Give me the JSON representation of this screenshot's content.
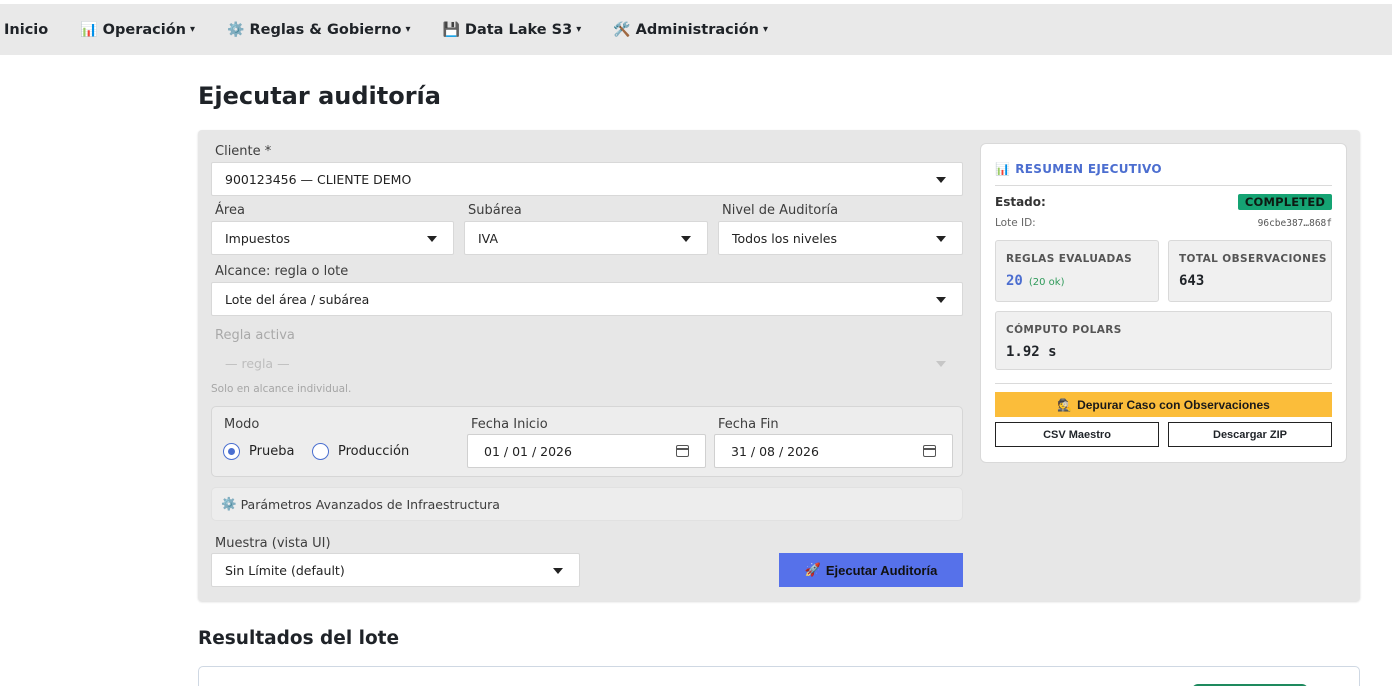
{
  "nav": {
    "items": [
      {
        "label": "Inicio",
        "icon": "",
        "caret": ""
      },
      {
        "label": "Operación",
        "icon": "📊",
        "caret": "▾"
      },
      {
        "label": "Reglas & Gobierno",
        "icon": "⚙️",
        "caret": "▾"
      },
      {
        "label": "Data Lake S3",
        "icon": "💾",
        "caret": "▾"
      },
      {
        "label": "Administración",
        "icon": "🛠️",
        "caret": "▾"
      }
    ]
  },
  "page": {
    "title": "Ejecutar auditoría"
  },
  "form": {
    "cliente_label": "Cliente *",
    "cliente_value": "900123456 — CLIENTE DEMO",
    "area_label": "Área",
    "area_value": "Impuestos",
    "subarea_label": "Subárea",
    "subarea_value": "IVA",
    "nivel_label": "Nivel de Auditoría",
    "nivel_value": "Todos los niveles",
    "alcance_label": "Alcance: regla o lote",
    "alcance_value": "Lote del área / subárea",
    "regla_label": "Regla activa",
    "regla_value": "— regla —",
    "regla_hint": "Solo en alcance individual.",
    "modo_label": "Modo",
    "modo_options": [
      "Prueba",
      "Producción"
    ],
    "modo_selected": "Prueba",
    "fecha_inicio_label": "Fecha Inicio",
    "fecha_inicio_value": "01 / 01 / 2026",
    "fecha_fin_label": "Fecha Fin",
    "fecha_fin_value": "31 / 08 / 2026",
    "advanced_icon": "⚙️",
    "advanced_label": "Parámetros Avanzados de Infraestructura",
    "muestra_label": "Muestra (vista UI)",
    "muestra_value": "Sin Límite (default)",
    "run_icon": "🚀",
    "run_label": "Ejecutar Auditoría"
  },
  "summary": {
    "icon": "📊",
    "title": "RESUMEN EJECUTIVO",
    "estado_label": "Estado:",
    "estado_value": "COMPLETED",
    "lote_label": "Lote ID:",
    "lote_value": "96cbe387…868f",
    "reglas_label": "REGLAS EVALUADAS",
    "reglas_value": "20",
    "reglas_ok": "(20 ok)",
    "obs_label": "TOTAL OBSERVACIONES",
    "obs_value": "643",
    "computo_label": "CÓMPUTO POLARS",
    "computo_value": "1.92 s",
    "debug_icon": "🕵️",
    "debug_label": "Depurar Caso con Observaciones",
    "csv_label": "CSV Maestro",
    "zip_label": "Descargar ZIP"
  },
  "results": {
    "title": "Resultados del lote"
  },
  "colors": {
    "accent": "#4c6ed0",
    "run_button": "#5671ea",
    "status": "#15a373",
    "warning": "#fbbd3a"
  }
}
